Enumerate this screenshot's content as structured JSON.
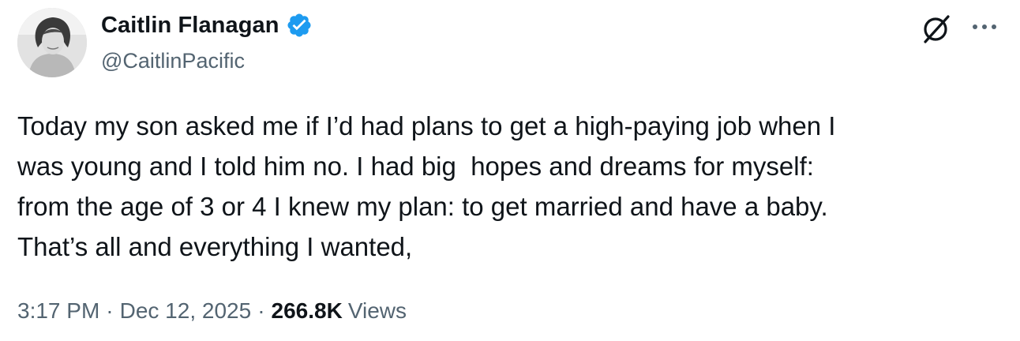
{
  "author": {
    "display_name": "Caitlin Flanagan",
    "handle": "@CaitlinPacific",
    "verified": true
  },
  "tweet": {
    "text": "Today my son asked me if I’d had plans to get a high-paying job when I\nwas young and I told him no. I had big  hopes and dreams for myself:\nfrom the age of 3 or 4 I knew my plan: to get married and have a baby.\nThat’s all and everything I wanted,"
  },
  "meta": {
    "time": "3:17 PM",
    "separator": "·",
    "date": "Dec 12, 2025",
    "views_count": "266.8K",
    "views_label": "Views"
  },
  "icons": {
    "verified": "verified-badge-icon",
    "grok": "grok-icon",
    "more": "more-icon"
  },
  "colors": {
    "text_primary": "#0f1419",
    "text_secondary": "#536471",
    "verified_blue": "#1d9bf0",
    "background": "#ffffff"
  }
}
